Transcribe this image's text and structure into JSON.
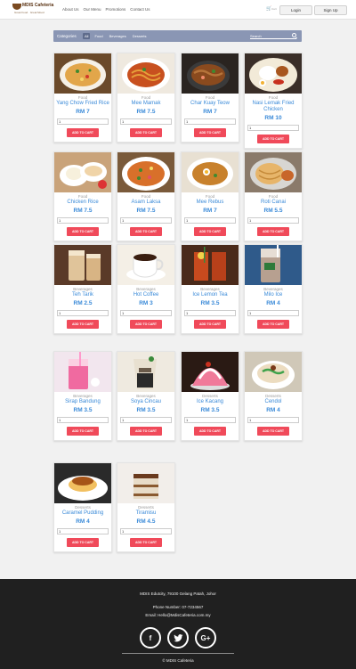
{
  "header": {
    "logo_name": "MDIS Cafeteria",
    "logo_tagline": "Great Food · Great Mood",
    "nav": [
      "About Us",
      "Our Menu",
      "Promotions",
      "Contact Us"
    ],
    "cart_label": "Cart",
    "login_label": "Login",
    "signup_label": "Sign Up"
  },
  "filter": {
    "label": "Categories",
    "tabs": [
      "All",
      "Food",
      "Beverages",
      "Desserts"
    ],
    "active_tab": "All",
    "search_placeholder": "Search"
  },
  "buttons": {
    "add_to_cart": "ADD TO CART"
  },
  "products": [
    {
      "category": "Food",
      "name": "Yang Chow Fried Rice",
      "price": "RM 7",
      "qty": "1",
      "img": "fried-rice"
    },
    {
      "category": "Food",
      "name": "Mee Mamak",
      "price": "RM 7.5",
      "qty": "1",
      "img": "mee-mamak"
    },
    {
      "category": "Food",
      "name": "Char Kuay Teow",
      "price": "RM 7",
      "qty": "1",
      "img": "char-kuay-teow"
    },
    {
      "category": "Food",
      "name": "Nasi Lemak Fried Chicken",
      "price": "RM 10",
      "qty": "1",
      "img": "nasi-lemak"
    },
    {
      "category": "Food",
      "name": "Chicken Rice",
      "price": "RM 7.5",
      "qty": "1",
      "img": "chicken-rice"
    },
    {
      "category": "Food",
      "name": "Asam Laksa",
      "price": "RM 7.5",
      "qty": "1",
      "img": "asam-laksa"
    },
    {
      "category": "Food",
      "name": "Mee Rebus",
      "price": "RM 7",
      "qty": "1",
      "img": "mee-rebus"
    },
    {
      "category": "Food",
      "name": "Roti Canai",
      "price": "RM 5.5",
      "qty": "1",
      "img": "roti-canai"
    },
    {
      "category": "Beverages",
      "name": "Teh Tarik",
      "price": "RM 2.5",
      "qty": "1",
      "img": "teh-tarik"
    },
    {
      "category": "Beverages",
      "name": "Hot Coffee",
      "price": "RM 3",
      "qty": "1",
      "img": "hot-coffee"
    },
    {
      "category": "Beverages",
      "name": "Ice Lemon Tea",
      "price": "RM 3.5",
      "qty": "1",
      "img": "ice-lemon-tea"
    },
    {
      "category": "Beverages",
      "name": "Milo Ice",
      "price": "RM 4",
      "qty": "1",
      "img": "milo-ice"
    },
    {
      "category": "Beverages",
      "name": "Sirap Bandung",
      "price": "RM 3.5",
      "qty": "1",
      "img": "sirap-bandung"
    },
    {
      "category": "Beverages",
      "name": "Soya Cincau",
      "price": "RM 3.5",
      "qty": "1",
      "img": "soya-cincau"
    },
    {
      "category": "Desserts",
      "name": "Ice Kacang",
      "price": "RM 3.5",
      "qty": "1",
      "img": "ice-kacang"
    },
    {
      "category": "Desserts",
      "name": "Cendol",
      "price": "RM 4",
      "qty": "1",
      "img": "cendol"
    },
    {
      "category": "Desserts",
      "name": "Caramel Pudding",
      "price": "RM 4",
      "qty": "1",
      "img": "caramel-pudding"
    },
    {
      "category": "Desserts",
      "name": "Tiramisu",
      "price": "RM 4.5",
      "qty": "1",
      "img": "tiramisu"
    }
  ],
  "footer": {
    "address": "MDIS Edutcity, 79100 Gelang Patah, Johor",
    "phone": "Phone Number: 07-7234567",
    "email": "Email: Hello@MdisCafeteria.com.my",
    "socials": [
      "facebook-icon",
      "twitter-icon",
      "google-plus-icon"
    ],
    "copyright": "© MDIS Cafeteria"
  },
  "colors": {
    "accent": "#3a8ad8",
    "add_button": "#f04a5a",
    "filter_bar": "#8a96b4",
    "footer": "#202020"
  }
}
